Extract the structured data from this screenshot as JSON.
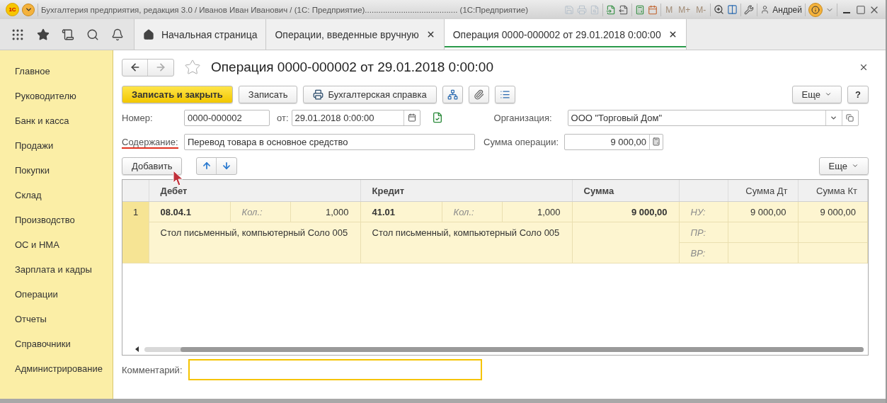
{
  "window": {
    "logo": "1С",
    "title": "Бухгалтерия предприятия, редакция 3.0 / Иванов Иван Иванович / (1С: Предприятие)......................................... (1С:Предприятие)",
    "memory_buttons": [
      {
        "label": "M",
        "disabled": true
      },
      {
        "label": "M+",
        "disabled": true
      },
      {
        "label": "M-",
        "disabled": true
      }
    ],
    "user": "Андрей"
  },
  "tabs": [
    {
      "kind": "home",
      "label": "Начальная страница",
      "selected": false
    },
    {
      "kind": "closable",
      "label": "Операции, введенные вручную",
      "selected": false
    },
    {
      "kind": "closable",
      "label": "Операция 0000-000002 от 29.01.2018 0:00:00",
      "selected": true
    }
  ],
  "sidebar": {
    "items": [
      {
        "label": "Главное"
      },
      {
        "label": "Руководителю"
      },
      {
        "label": "Банк и касса"
      },
      {
        "label": "Продажи"
      },
      {
        "label": "Покупки"
      },
      {
        "label": "Склад"
      },
      {
        "label": "Производство"
      },
      {
        "label": "ОС и НМА"
      },
      {
        "label": "Зарплата и кадры"
      },
      {
        "label": "Операции"
      },
      {
        "label": "Отчеты"
      },
      {
        "label": "Справочники"
      },
      {
        "label": "Администрирование"
      }
    ]
  },
  "form": {
    "title": "Операция 0000-000002 от 29.01.2018 0:00:00",
    "favorite": false,
    "toolbar": {
      "primary": "Записать и закрыть",
      "save": "Записать",
      "report": "Бухгалтерская справка",
      "more": "Еще",
      "help": "?"
    },
    "fields": {
      "number_label": "Номер:",
      "number": "0000-000002",
      "date_label": "от:",
      "date": "29.01.2018  0:00:00",
      "org_label": "Организация:",
      "org": "ООО \"Торговый Дом\"",
      "content_label": "Содержание:",
      "content": "Перевод товара в основное средство",
      "sum_label": "Сумма операции:",
      "sum": "9 000,00"
    },
    "table_toolbar": {
      "add": "Добавить",
      "more": "Еще"
    },
    "table": {
      "columns": [
        "Дебет",
        "Кредит",
        "Сумма",
        "Сумма Дт",
        "Сумма Кт"
      ],
      "rows": [
        {
          "selected": true,
          "number": "1",
          "debit": {
            "account": "08.04.1",
            "qty_label": "Кол.:",
            "qty": "1,000",
            "subconto": "Стол письменный, компьютерный Соло 005"
          },
          "credit": {
            "account": "41.01",
            "qty_label": "Кол.:",
            "qty": "1,000",
            "subconto": "Стол письменный, компьютерный Соло 005"
          },
          "sum": "9 000,00",
          "registers": [
            {
              "label": "НУ:",
              "dt": "9 000,00",
              "kt": "9 000,00"
            },
            {
              "label": "ПР:"
            },
            {
              "label": "ВР:"
            }
          ]
        }
      ]
    },
    "comment": {
      "label": "Комментарий:",
      "focused": true
    }
  }
}
